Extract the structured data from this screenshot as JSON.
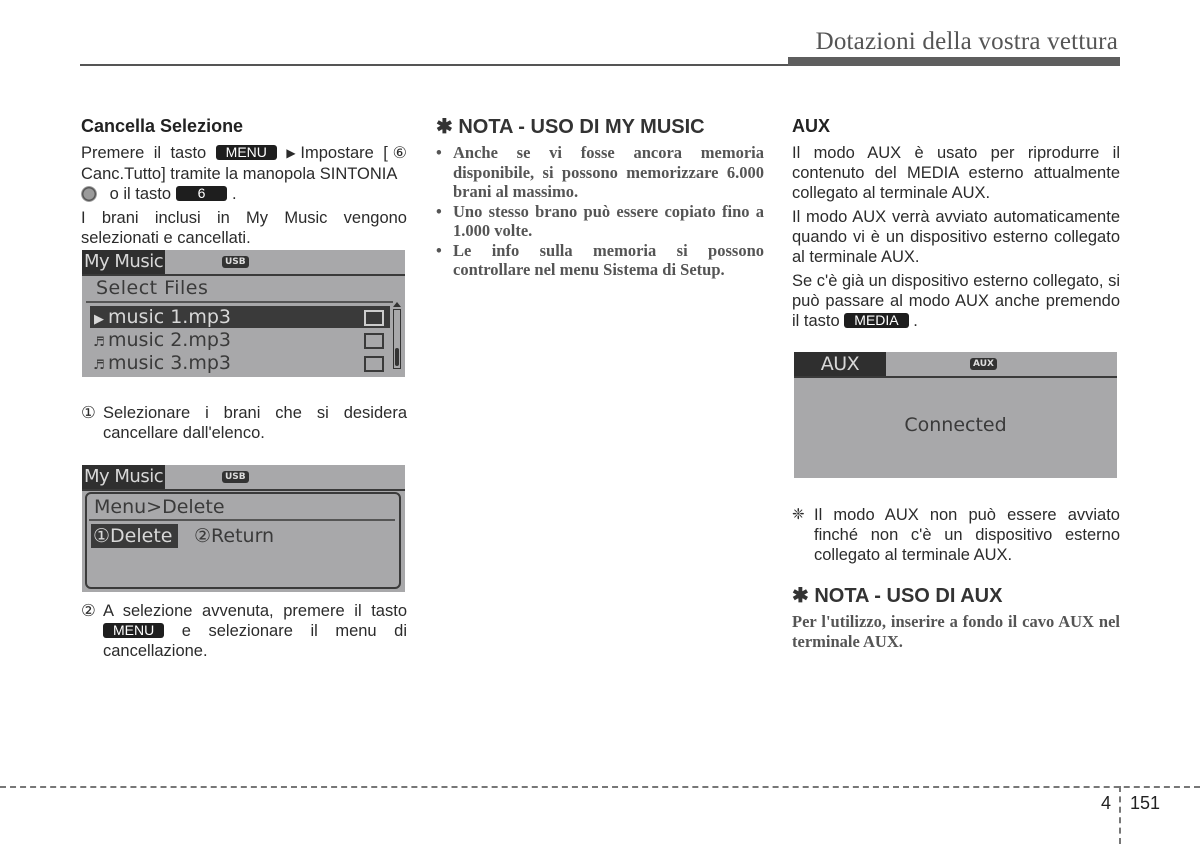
{
  "header": {
    "title": "Dotazioni della vostra vettura"
  },
  "col1": {
    "heading": "Cancella Selezione",
    "para1": {
      "t1": "Premere il tasto ",
      "key_menu": "MENU",
      "arrow": "▶",
      "t2": "Impostare [",
      "circled": "⑥",
      "t3": " Canc.Tutto] tramite la manopola SINTONIA ",
      "t4": " o il tasto ",
      "key_6": "6",
      "t5": " ."
    },
    "para2": "I brani inclusi in My Music vengono selezionati e cancellati.",
    "screen1": {
      "tab": "My Music",
      "badge": "USB",
      "subtitle": "Select Files",
      "rows": [
        {
          "icon": "▶",
          "name": "music 1.mp3",
          "selected": true,
          "checked": false
        },
        {
          "icon": "♬",
          "name": "music 2.mp3",
          "selected": false,
          "checked": false
        },
        {
          "icon": "♬",
          "name": "music 3.mp3",
          "selected": false,
          "checked": false
        }
      ]
    },
    "step1": {
      "num": "①",
      "text": "Selezionare i brani che si desidera cancellare dall'elenco."
    },
    "screen2": {
      "tab": "My Music",
      "badge": "USB",
      "subtitle": "Menu>Delete",
      "option1": "①Delete",
      "option2": "②Return"
    },
    "step2": {
      "num": "②",
      "t1": "A selezione avvenuta, premere il tasto ",
      "key_menu": "MENU",
      "t2": " e selezionare il menu di cancellazione."
    }
  },
  "col2": {
    "note_heading": "✱ NOTA - USO DI MY MUSIC",
    "bullets": [
      "Anche se vi fosse ancora memoria disponibile, si possono memorizzare 6.000 brani  al massimo.",
      "Uno stesso brano può essere copiato fino a 1.000 volte.",
      "Le info sulla memoria si possono controllare nel menu Sistema di Setup."
    ]
  },
  "col3": {
    "heading": "AUX",
    "para1": "Il modo AUX è usato per riprodurre il contenuto del MEDIA esterno attualmente collegato al terminale AUX.",
    "para2": "Il modo AUX verrà avviato automaticamente quando vi è un dispositivo esterno collegato al terminale AUX.",
    "para3": {
      "t1": "Se c'è già un dispositivo esterno collegato, si può passare al modo AUX anche premendo il tasto ",
      "key_media": "MEDIA",
      "t2": " ."
    },
    "screen3": {
      "tab": "AUX",
      "badge": "AUX",
      "status": "Connected"
    },
    "remark": {
      "symbol": "❈",
      "text": "Il modo AUX non può essere avviato finché non c'è un dispositivo esterno collegato al terminale AUX."
    },
    "note_heading": "✱ NOTA - USO DI AUX",
    "note_body": "Per l'utilizzo, inserire a fondo il cavo AUX nel terminale AUX."
  },
  "footer": {
    "chapter": "4",
    "page": "151"
  }
}
